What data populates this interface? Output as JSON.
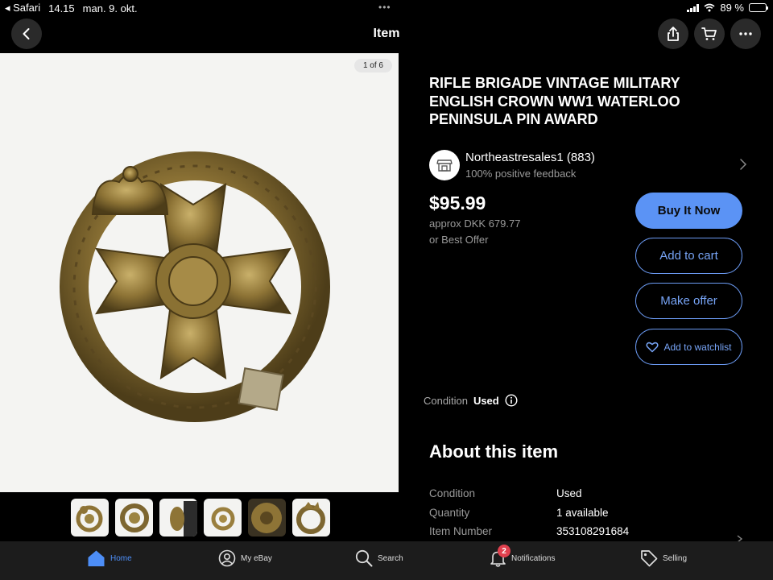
{
  "status_bar": {
    "app": "◂ Safari",
    "time": "14.15",
    "date": "man. 9. okt.",
    "battery": "89 %",
    "battery_level": 0.89
  },
  "header": {
    "title": "Item",
    "back_icon": "chevron-left-icon",
    "share_icon": "share-icon",
    "cart_icon": "cart-icon",
    "more_icon": "more-icon"
  },
  "gallery": {
    "counter": "1 of 6",
    "thumbnail_count": 6
  },
  "item": {
    "title": "RIFLE BRIGADE VINTAGE MILITARY ENGLISH CROWN WW1 WATERLOO PENINSULA PIN AWARD",
    "price": "$95.99",
    "approx": "approx DKK 679.77",
    "best_offer": "or Best Offer",
    "condition_label": "Condition",
    "condition_value": "Used"
  },
  "seller": {
    "name": "Northeastresales1 (883)",
    "feedback": "100% positive feedback"
  },
  "actions": {
    "buy_now": "Buy It Now",
    "add_to_cart": "Add to cart",
    "make_offer": "Make offer",
    "watchlist": "Add to watchlist"
  },
  "about": {
    "heading": "About this item",
    "rows": [
      {
        "label": "Condition",
        "value": "Used"
      },
      {
        "label": "Quantity",
        "value": "1 available"
      },
      {
        "label": "Item Number",
        "value": "353108291684"
      }
    ]
  },
  "bottom_nav": {
    "items": [
      {
        "label": "Home",
        "icon": "home-icon"
      },
      {
        "label": "My eBay",
        "icon": "user-icon"
      },
      {
        "label": "Search",
        "icon": "search-icon"
      },
      {
        "label": "Notifications",
        "icon": "bell-icon",
        "badge": "2"
      },
      {
        "label": "Selling",
        "icon": "tag-icon"
      }
    ]
  },
  "colors": {
    "accent": "#5b93f5",
    "active_nav": "#4d8ef7",
    "badge": "#e0404e",
    "background": "#000000"
  }
}
